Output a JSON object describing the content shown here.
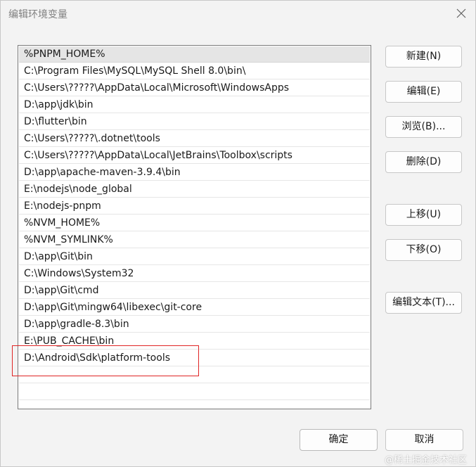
{
  "window": {
    "title": "编辑环境变量"
  },
  "paths": [
    "%PNPM_HOME%",
    "C:\\Program Files\\MySQL\\MySQL Shell 8.0\\bin\\",
    "C:\\Users\\?????\\AppData\\Local\\Microsoft\\WindowsApps",
    "D:\\app\\jdk\\bin",
    "D:\\flutter\\bin",
    "C:\\Users\\?????\\.dotnet\\tools",
    "C:\\Users\\?????\\AppData\\Local\\JetBrains\\Toolbox\\scripts",
    "D:\\app\\apache-maven-3.9.4\\bin",
    "E:\\nodejs\\node_global",
    "E:\\nodejs-pnpm",
    "%NVM_HOME%",
    "%NVM_SYMLINK%",
    "D:\\app\\Git\\bin",
    "C:\\Windows\\System32",
    "D:\\app\\Git\\cmd",
    "D:\\app\\Git\\mingw64\\libexec\\git-core",
    "D:\\app\\gradle-8.3\\bin",
    "E:\\PUB_CACHE\\bin",
    "D:\\Android\\Sdk\\platform-tools"
  ],
  "selected_index": 0,
  "buttons": {
    "new": "新建(N)",
    "edit": "编辑(E)",
    "browse": "浏览(B)...",
    "delete": "删除(D)",
    "move_up": "上移(U)",
    "move_down": "下移(O)",
    "edit_text": "编辑文本(T)...",
    "ok": "确定",
    "cancel": "取消"
  },
  "watermark": "@稀土掘金技术社区"
}
